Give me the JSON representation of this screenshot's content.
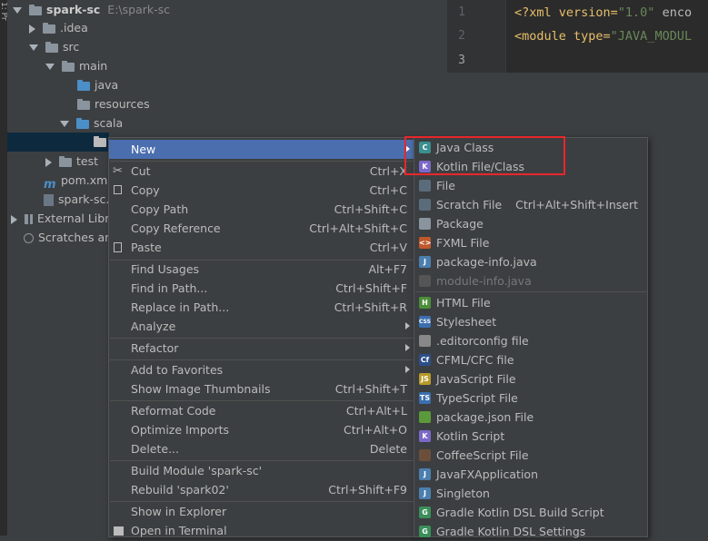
{
  "side_strip_label": "1: Pr",
  "project_tree": {
    "root_name": "spark-sc",
    "root_path": "E:\\spark-sc",
    "items": [
      {
        "label": ".idea"
      },
      {
        "label": "src"
      },
      {
        "label": "main"
      },
      {
        "label": "java"
      },
      {
        "label": "resources"
      },
      {
        "label": "scala"
      },
      {
        "label": "test"
      },
      {
        "label": "pom.xml"
      },
      {
        "label": "spark-sc."
      },
      {
        "label": "External Libr"
      },
      {
        "label": "Scratches ar"
      }
    ]
  },
  "editor": {
    "line_numbers": [
      "1",
      "2",
      "3"
    ],
    "line1_tag": "<?xml version=",
    "line1_value": "\"1.0\"",
    "line1_rest": " enco",
    "line2_tag": "<module type=",
    "line2_value": "\"JAVA_MODUL"
  },
  "context_menu": {
    "items": [
      {
        "label": "New",
        "shortcut": ""
      },
      {
        "label": "Cut",
        "shortcut": "Ctrl+X"
      },
      {
        "label": "Copy",
        "shortcut": "Ctrl+C"
      },
      {
        "label": "Copy Path",
        "shortcut": "Ctrl+Shift+C"
      },
      {
        "label": "Copy Reference",
        "shortcut": "Ctrl+Alt+Shift+C"
      },
      {
        "label": "Paste",
        "shortcut": "Ctrl+V"
      },
      {
        "label": "Find Usages",
        "shortcut": "Alt+F7"
      },
      {
        "label": "Find in Path...",
        "shortcut": "Ctrl+Shift+F"
      },
      {
        "label": "Replace in Path...",
        "shortcut": "Ctrl+Shift+R"
      },
      {
        "label": "Analyze",
        "shortcut": ""
      },
      {
        "label": "Refactor",
        "shortcut": ""
      },
      {
        "label": "Add to Favorites",
        "shortcut": ""
      },
      {
        "label": "Show Image Thumbnails",
        "shortcut": "Ctrl+Shift+T"
      },
      {
        "label": "Reformat Code",
        "shortcut": "Ctrl+Alt+L"
      },
      {
        "label": "Optimize Imports",
        "shortcut": "Ctrl+Alt+O"
      },
      {
        "label": "Delete...",
        "shortcut": "Delete"
      },
      {
        "label": "Build Module 'spark-sc'",
        "shortcut": ""
      },
      {
        "label": "Rebuild 'spark02'",
        "shortcut": "Ctrl+Shift+F9"
      },
      {
        "label": "Show in Explorer",
        "shortcut": ""
      },
      {
        "label": "Open in Terminal",
        "shortcut": ""
      }
    ]
  },
  "new_submenu": {
    "items": [
      {
        "label": "Java Class",
        "shortcut": "",
        "icon": "java-class-icon",
        "color": "#3a8f8f",
        "glyph": "C"
      },
      {
        "label": "Kotlin File/Class",
        "shortcut": "",
        "icon": "kotlin-icon",
        "color": "#7b68c8",
        "glyph": "K"
      },
      {
        "label": "File",
        "shortcut": "",
        "icon": "file-icon",
        "color": "#5a6b7b",
        "glyph": ""
      },
      {
        "label": "Scratch File",
        "shortcut": "Ctrl+Alt+Shift+Insert",
        "icon": "scratch-file-icon",
        "color": "#5a6b7b",
        "glyph": ""
      },
      {
        "label": "Package",
        "shortcut": "",
        "icon": "package-icon",
        "color": "#8a949e",
        "glyph": ""
      },
      {
        "label": "FXML File",
        "shortcut": "",
        "icon": "fxml-icon",
        "color": "#c0582b",
        "glyph": "<>"
      },
      {
        "label": "package-info.java",
        "shortcut": "",
        "icon": "package-info-icon",
        "color": "#4b7fb0",
        "glyph": "J"
      },
      {
        "label": "module-info.java",
        "shortcut": "",
        "icon": "module-info-icon",
        "color": "#555",
        "glyph": "",
        "disabled": true
      },
      {
        "label": "HTML File",
        "shortcut": "",
        "icon": "html-icon",
        "color": "#4b8f3a",
        "glyph": "H"
      },
      {
        "label": "Stylesheet",
        "shortcut": "",
        "icon": "css-icon",
        "color": "#3a6fb0",
        "glyph": "CSS"
      },
      {
        "label": ".editorconfig file",
        "shortcut": "",
        "icon": "editorconfig-icon",
        "color": "#888",
        "glyph": ""
      },
      {
        "label": "CFML/CFC file",
        "shortcut": "",
        "icon": "cfml-icon",
        "color": "#2b4f8a",
        "glyph": "Cf"
      },
      {
        "label": "JavaScript File",
        "shortcut": "",
        "icon": "javascript-icon",
        "color": "#b89a2a",
        "glyph": "JS"
      },
      {
        "label": "TypeScript File",
        "shortcut": "",
        "icon": "typescript-icon",
        "color": "#3a6fb0",
        "glyph": "TS"
      },
      {
        "label": "package.json File",
        "shortcut": "",
        "icon": "package-json-icon",
        "color": "#5a9a3a",
        "glyph": ""
      },
      {
        "label": "Kotlin Script",
        "shortcut": "",
        "icon": "kotlin-script-icon",
        "color": "#7b68c8",
        "glyph": "K"
      },
      {
        "label": "CoffeeScript File",
        "shortcut": "",
        "icon": "coffeescript-icon",
        "color": "#6b4f3a",
        "glyph": ""
      },
      {
        "label": "JavaFXApplication",
        "shortcut": "",
        "icon": "javafx-icon",
        "color": "#4b7fb0",
        "glyph": "J"
      },
      {
        "label": "Singleton",
        "shortcut": "",
        "icon": "singleton-icon",
        "color": "#4b7fb0",
        "glyph": "J"
      },
      {
        "label": "Gradle Kotlin DSL Build Script",
        "shortcut": "",
        "icon": "gradle-icon",
        "color": "#3a8f5a",
        "glyph": "G"
      },
      {
        "label": "Gradle Kotlin DSL Settings",
        "shortcut": "",
        "icon": "gradle-icon",
        "color": "#3a8f5a",
        "glyph": "G"
      }
    ]
  },
  "colors": {
    "highlight": "#4b6eaf",
    "annotation_box": "#e8262b"
  }
}
